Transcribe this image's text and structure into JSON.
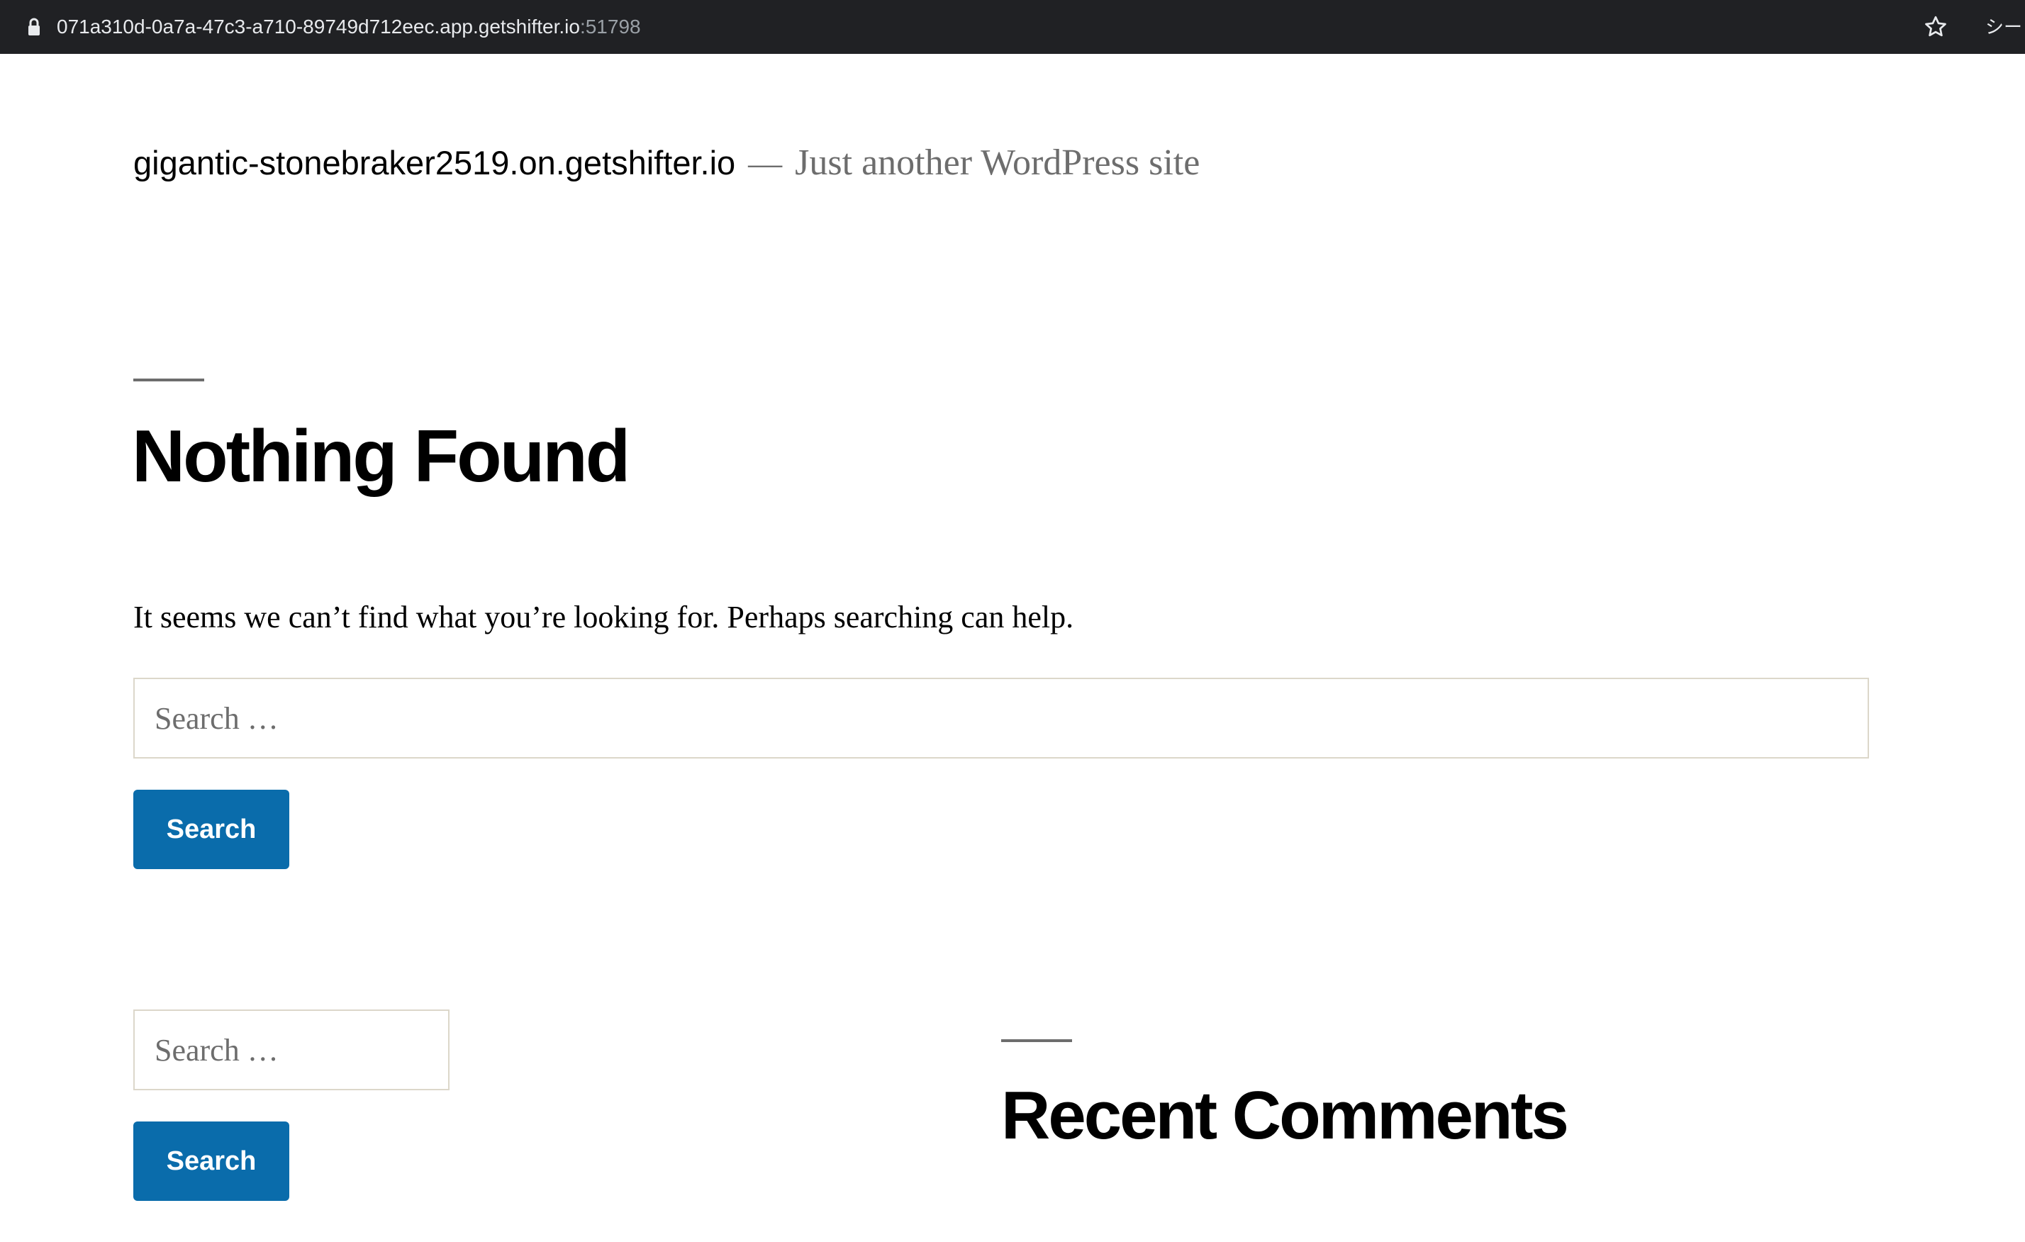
{
  "browser": {
    "url_host": "071a310d-0a7a-47c3-a710-89749d712eec.app.getshifter.io",
    "url_port": ":51798",
    "extension_text": "シー"
  },
  "site": {
    "title": "gigantic-stonebraker2519.on.getshifter.io",
    "separator": "—",
    "description": "Just another WordPress site"
  },
  "main": {
    "page_title": "Nothing Found",
    "message": "It seems we can’t find what you’re looking for. Perhaps searching can help.",
    "search": {
      "placeholder": "Search …",
      "value": "",
      "button_label": "Search"
    }
  },
  "footer_widgets": {
    "search": {
      "placeholder": "Search …",
      "value": "",
      "button_label": "Search"
    },
    "recent_comments": {
      "title": "Recent Comments"
    }
  },
  "colors": {
    "accent": "#0a6cab",
    "secondary_text": "#6d6d6d",
    "browser_bar": "#202124"
  }
}
